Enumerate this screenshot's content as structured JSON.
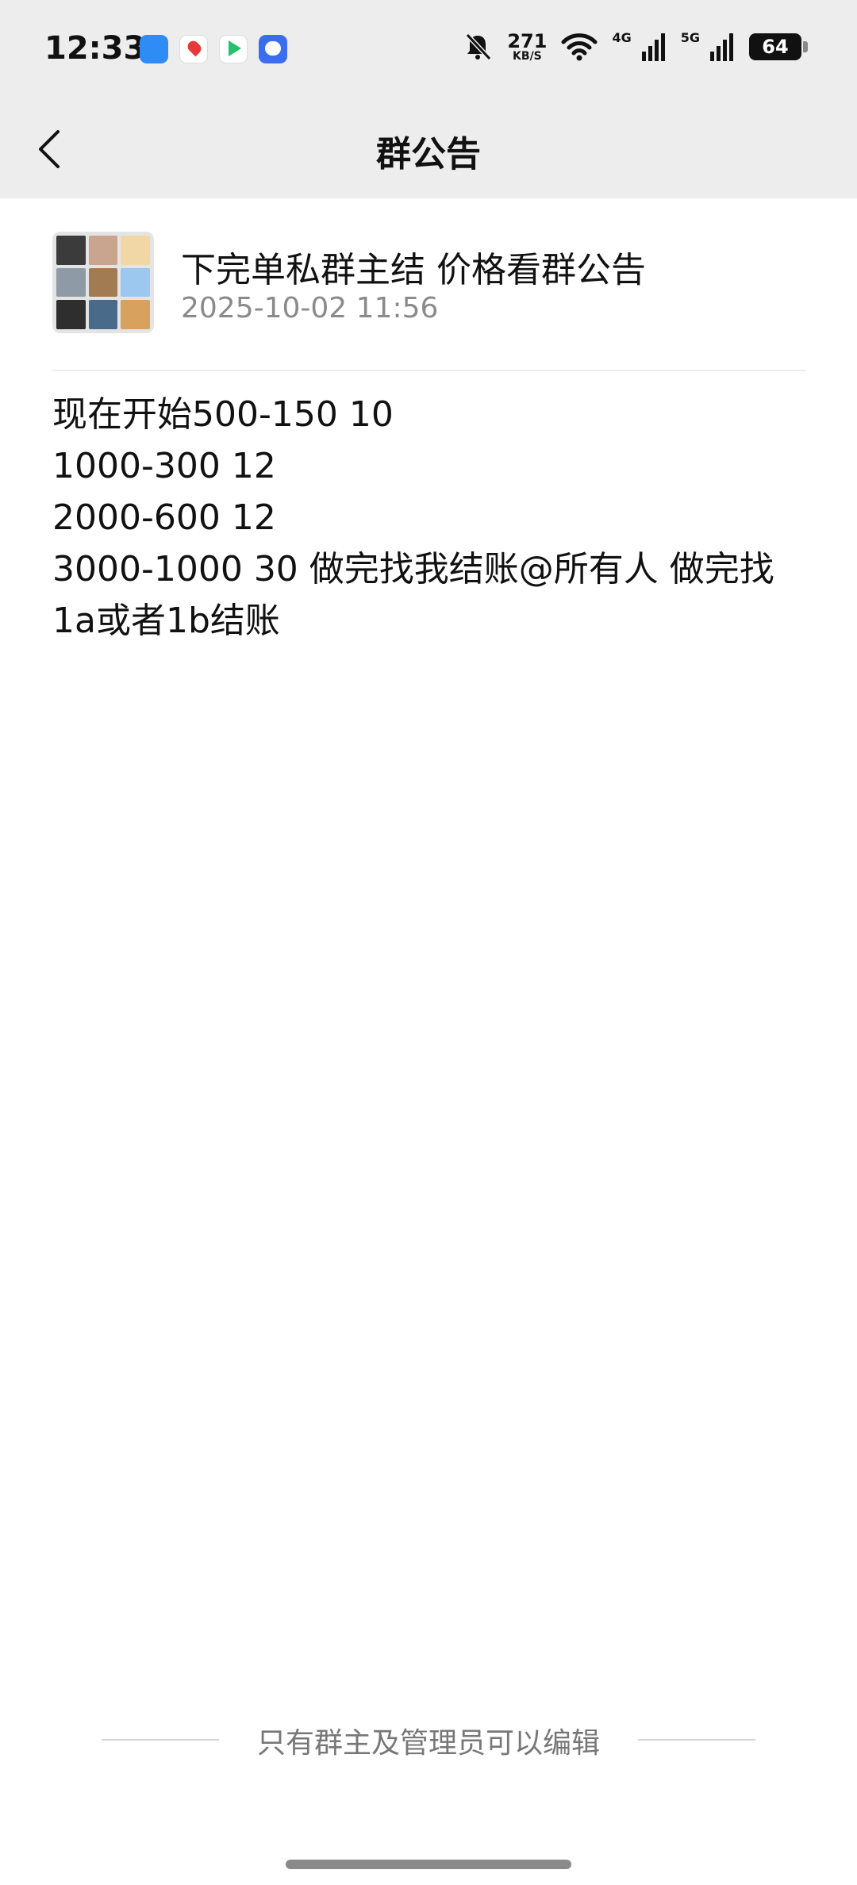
{
  "status_bar": {
    "time": "12:33",
    "net_speed_value": "271",
    "net_speed_unit": "KB/S",
    "net_1": "4G",
    "net_2": "5G",
    "battery": "64"
  },
  "nav": {
    "title": "群公告"
  },
  "announcement": {
    "group_name": "下完单私群主结 价格看群公告",
    "timestamp": "2025-10-02 11:56",
    "lines": [
      "现在开始500-150 10",
      "1000-300 12",
      "2000-600 12",
      "3000-1000 30 做完找我结账@所有人  做完找",
      "1a或者1b结账"
    ]
  },
  "footer": {
    "note": "只有群主及管理员可以编辑"
  },
  "colors": {
    "header_bg": "#ededed",
    "page_bg": "#ffffff",
    "muted_text": "#8a8a8a"
  }
}
